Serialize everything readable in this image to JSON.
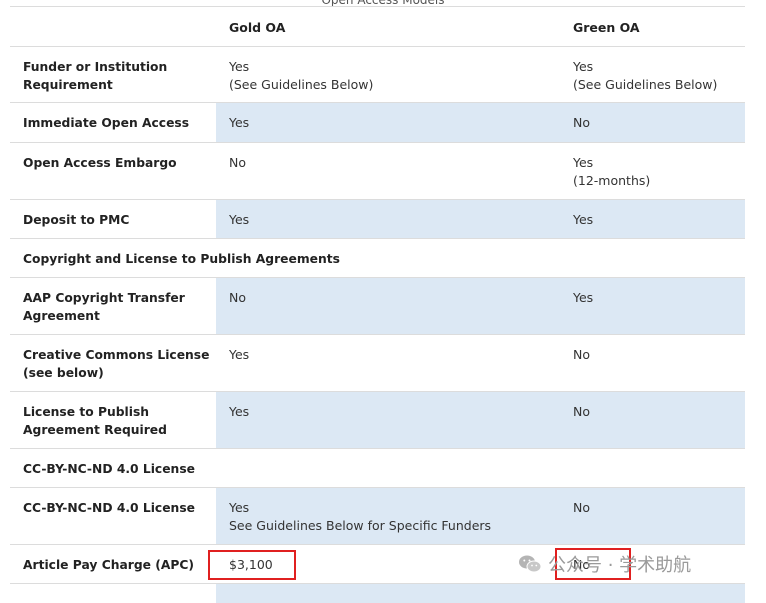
{
  "caption": "Open Access Models",
  "columns": {
    "gold": "Gold OA",
    "green": "Green OA"
  },
  "rows": [
    {
      "label": "Funder or Institution Requirement",
      "label_lines": [
        "Funder or Institution",
        "Requirement"
      ],
      "gold": [
        "Yes",
        "(See Guidelines Below)"
      ],
      "green": [
        "Yes",
        "(See Guidelines Below)"
      ]
    },
    {
      "label": "Immediate Open Access",
      "gold": [
        "Yes"
      ],
      "green": [
        "No"
      ]
    },
    {
      "label": "Open Access Embargo",
      "gold": [
        "No"
      ],
      "green": [
        "Yes",
        "(12-months)"
      ]
    },
    {
      "label": "Deposit to PMC",
      "gold": [
        "Yes"
      ],
      "green": [
        "Yes"
      ]
    },
    {
      "section": "Copyright and License to Publish Agreements"
    },
    {
      "label": "AAP Copyright Transfer Agreement",
      "label_lines": [
        "AAP Copyright Transfer",
        "Agreement"
      ],
      "gold": [
        "No"
      ],
      "green": [
        "Yes"
      ]
    },
    {
      "label": "Creative Commons License (see below)",
      "label_lines": [
        "Creative Commons License",
        "(see below)"
      ],
      "gold": [
        "Yes"
      ],
      "green": [
        "No"
      ]
    },
    {
      "label": "License to Publish Agreement Required",
      "label_lines": [
        "License to Publish",
        "Agreement Required"
      ],
      "gold": [
        "Yes"
      ],
      "green": [
        "No"
      ]
    },
    {
      "section": "CC-BY-NC-ND 4.0 License"
    },
    {
      "label": "CC-BY-NC-ND 4.0 License",
      "gold": [
        "Yes",
        "See Guidelines Below for Specific Funders"
      ],
      "green": [
        "No"
      ]
    },
    {
      "label": "Article Pay Charge (APC)",
      "gold": [
        "$3,100"
      ],
      "green": [
        "No"
      ]
    }
  ],
  "watermark": {
    "text": "公众号 · 学术助航",
    "icon": "wechat-icon"
  },
  "colors": {
    "shaded_cell": "#dce8f4",
    "highlight_box": "#e02020",
    "divider": "#dcdcdc"
  }
}
